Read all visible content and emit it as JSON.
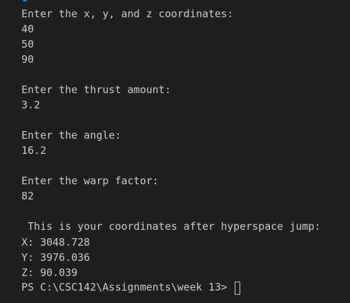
{
  "terminal": {
    "scrolled_marker": "1",
    "lines": [
      "Enter the x, y, and z coordinates:",
      "40",
      "50",
      "90",
      "",
      "Enter the thrust amount:",
      "3.2",
      "",
      "Enter the angle:",
      "16.2",
      "",
      "Enter the warp factor:",
      "82",
      "",
      " This is your coordinates after hyperspace jump:",
      "X: 3048.728",
      "Y: 3976.036",
      "Z: 90.039"
    ],
    "prompt": "PS C:\\CSC142\\Assignments\\week 13> "
  },
  "colors": {
    "background": "#1e1e1e",
    "text": "#cccccc",
    "marker": "#3794ff"
  }
}
